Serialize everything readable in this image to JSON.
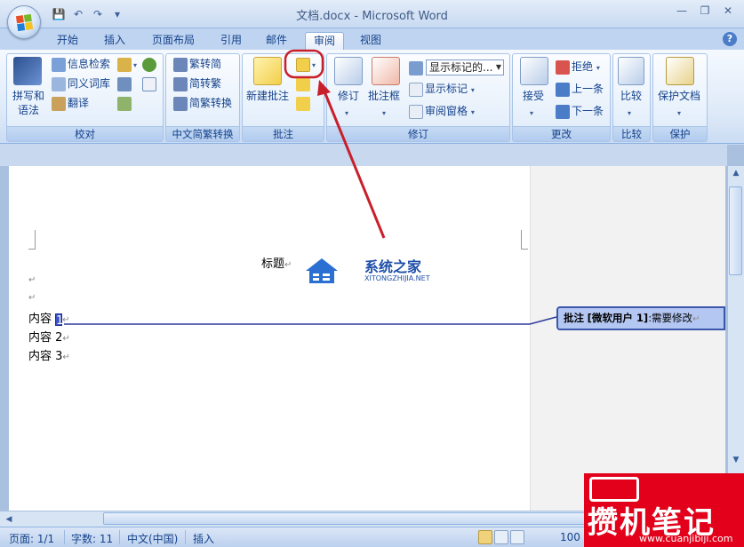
{
  "window": {
    "title": "文档.docx - Microsoft Word",
    "controls": [
      "—",
      "❐",
      "✕"
    ]
  },
  "tabs": [
    {
      "label": "开始",
      "active": false
    },
    {
      "label": "插入",
      "active": false
    },
    {
      "label": "页面布局",
      "active": false
    },
    {
      "label": "引用",
      "active": false
    },
    {
      "label": "邮件",
      "active": false
    },
    {
      "label": "审阅",
      "active": true
    },
    {
      "label": "视图",
      "active": false
    }
  ],
  "ribbon": {
    "proofing": {
      "label": "校对",
      "spelling": "拼写和语法",
      "spelling_line1": "拼写和",
      "spelling_line2": "语法",
      "research": "信息检索",
      "thesaurus": "同义词库",
      "translate": "翻译"
    },
    "chinese_conversion": {
      "label": "中文简繁转换",
      "to_simplified": "繁转简",
      "to_traditional": "简转繁",
      "conversion": "简繁转换"
    },
    "comments": {
      "label": "批注",
      "new_comment": "新建批注"
    },
    "tracking": {
      "label": "修订",
      "track_changes": "修订",
      "balloons": "批注框",
      "display_combo": "显示标记的...",
      "show_markup": "显示标记",
      "reviewing_pane": "审阅窗格"
    },
    "changes": {
      "label": "更改",
      "accept": "接受",
      "reject": "拒绝",
      "previous": "上一条",
      "next": "下一条"
    },
    "compare": {
      "label": "比较",
      "compare": "比较"
    },
    "protect": {
      "label": "保护",
      "protect_document": "保护文档"
    }
  },
  "document": {
    "title_text": "标题",
    "lines": [
      "内容 1",
      "内容 2",
      "内容 3"
    ],
    "line1_prefix": "内容 ",
    "line1_anchor": "1",
    "line2": "内容 2",
    "line3": "内容 3",
    "para_mark": "↵"
  },
  "comment": {
    "label": "批注",
    "author": "[微软用户 1]",
    "text": ":需要修改"
  },
  "status": {
    "page": "页面: 1/1",
    "words": "字数: 11",
    "language": "中文(中国)",
    "mode": "插入",
    "zoom": "100"
  },
  "watermarks": {
    "site_cn": "系统之家",
    "site_en": "XITONGZHIJIA.NET",
    "brand": "攒机笔记",
    "brand_url": "www.cuanjibiji.com"
  },
  "colors": {
    "accent": "#15428b",
    "annotation_red": "#c8202b",
    "comment_fill": "#b4c7f3",
    "comment_border": "#3b57a8",
    "watermark_red": "#e2001a"
  }
}
